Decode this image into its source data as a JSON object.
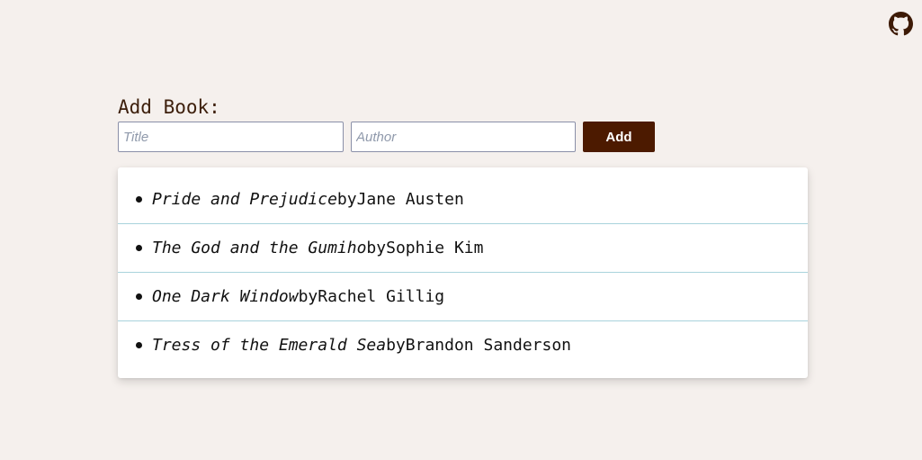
{
  "header": {
    "github_icon": "github-icon"
  },
  "add_book": {
    "heading": "Add Book:",
    "title_placeholder": "Title",
    "title_value": "",
    "author_placeholder": "Author",
    "author_value": "",
    "add_label": "Add"
  },
  "books": [
    {
      "title": "Pride and Prejudice",
      "by": "by",
      "author": "Jane Austen"
    },
    {
      "title": "The God and the Gumiho",
      "by": "by",
      "author": "Sophie Kim"
    },
    {
      "title": "One Dark Window",
      "by": "by",
      "author": "Rachel Gillig"
    },
    {
      "title": "Tress of the Emerald Sea",
      "by": "by",
      "author": "Brandon Sanderson"
    }
  ],
  "colors": {
    "background": "#f5f0ed",
    "accent": "#4c1a00",
    "heading": "#3d1f0c",
    "divider": "#a9d3dc"
  }
}
